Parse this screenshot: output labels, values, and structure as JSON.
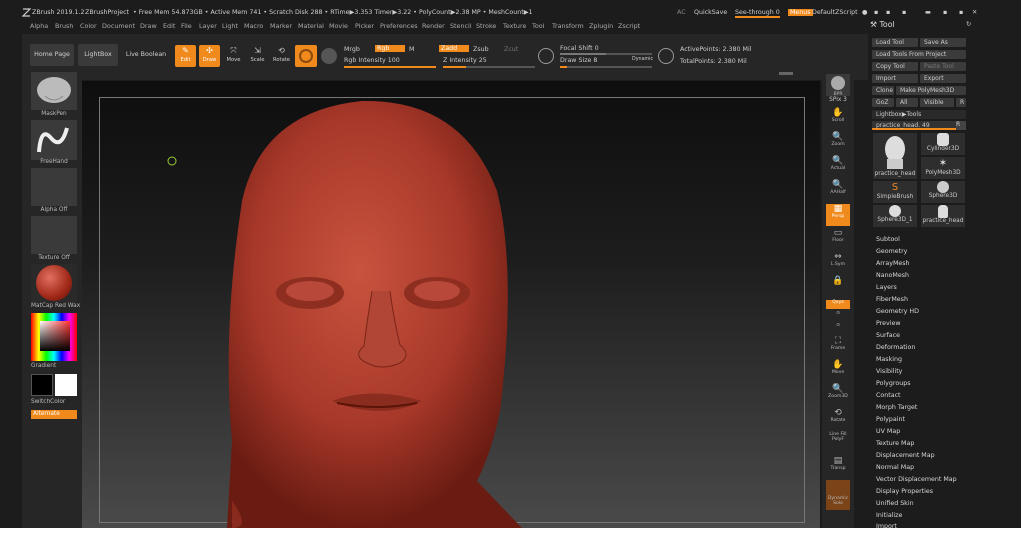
{
  "titlebar": {
    "app": "ZBrush 2019.1.2",
    "project": "ZBrushProject",
    "stats": "• Free Mem 54.873GB • Active Mem 741 • Scratch Disk 288 • RTime▶3.353 Timer▶3.22 • PolyCount▶2.38 MP • MeshCount▶1",
    "ac": "AC",
    "quicksave": "QuickSave",
    "seethrough": "See-through",
    "seethrough_value": "0",
    "menus": "Menus",
    "defaultzscript": "DefaultZScript"
  },
  "menubar": [
    "Alpha",
    "Brush",
    "Color",
    "Document",
    "Draw",
    "Edit",
    "File",
    "Layer",
    "Light",
    "Macro",
    "Marker",
    "Material",
    "Movie",
    "Picker",
    "Preferences",
    "Render",
    "Stencil",
    "Stroke",
    "Texture",
    "Tool",
    "Transform",
    "Zplugin",
    "Zscript"
  ],
  "toolbar": {
    "home_page": "Home Page",
    "lightbox": "LightBox",
    "live_boolean": "Live Boolean",
    "edit": "Edit",
    "draw": "Draw",
    "move": "Move",
    "scale": "Scale",
    "rotate": "Rotate",
    "mrgb": "Mrgb",
    "rgb": "Rgb",
    "m": "M",
    "zadd": "Zadd",
    "zsub": "Zsub",
    "zcut": "Zcut",
    "rgb_intensity_label": "Rgb Intensity",
    "rgb_intensity_value": "100",
    "z_intensity_label": "Z Intensity",
    "z_intensity_value": "25",
    "focal_shift_label": "Focal Shift",
    "focal_shift_value": "0",
    "draw_size_label": "Draw Size",
    "draw_size_value": "8",
    "dynamic": "Dynamic",
    "active_points": "ActivePoints: 2.380 Mil",
    "total_points": "TotalPoints: 2.380 Mil"
  },
  "leftshelf": {
    "brush": "MaskPen",
    "stroke": "FreeHand",
    "alpha": "Alpha Off",
    "texture": "Texture Off",
    "material": "MatCap Red Wax",
    "gradient": "Gradient",
    "switchcolor": "SwitchColor",
    "alternate": "Alternate"
  },
  "rightshelf": {
    "bpr": "BPR",
    "spix_label": "SPix",
    "spix_value": "3",
    "items": [
      "Scroll",
      "Zoom",
      "Actual",
      "AAHalf",
      "Persp",
      "Floor",
      "L.Sym",
      "",
      "Qxyz",
      "",
      "",
      "Frame",
      "Move",
      "Zoom3D",
      "Rotate",
      "Line Fill\nPolyF",
      "Transp",
      "Dynamic\nSolo"
    ]
  },
  "toolpanel": {
    "title": "Tool",
    "load_tool": "Load Tool",
    "save_as": "Save As",
    "load_from_project": "Load Tools From Project",
    "copy_tool": "Copy Tool",
    "paste_tool": "Paste Tool",
    "import": "Import",
    "export": "Export",
    "clone": "Clone",
    "make_polymesh": "Make PolyMesh3D",
    "goz": "GoZ",
    "all": "All",
    "visible": "Visible",
    "r": "R",
    "lightbox_tools": "Lightbox▶Tools",
    "current_tool": "practice_head. 49",
    "thumbs": [
      "practice_head",
      "Cylinder3D",
      "PolyMesh3D",
      "SimpleBrush",
      "Sphere3D",
      "Sphere3D_1",
      "practice_head"
    ],
    "subpalettes": [
      "Subtool",
      "Geometry",
      "ArrayMesh",
      "NanoMesh",
      "Layers",
      "FiberMesh",
      "Geometry HD",
      "Preview",
      "Surface",
      "Deformation",
      "Masking",
      "Visibility",
      "Polygroups",
      "Contact",
      "Morph Target",
      "Polypaint",
      "UV Map",
      "Texture Map",
      "Displacement Map",
      "Normal Map",
      "Vector Displacement Map",
      "Display Properties",
      "Unified Skin",
      "Initialize",
      "Import"
    ]
  },
  "colors": {
    "accent": "#f08a1c",
    "model": "#b03a2a",
    "bg": "#1c1c1c"
  }
}
